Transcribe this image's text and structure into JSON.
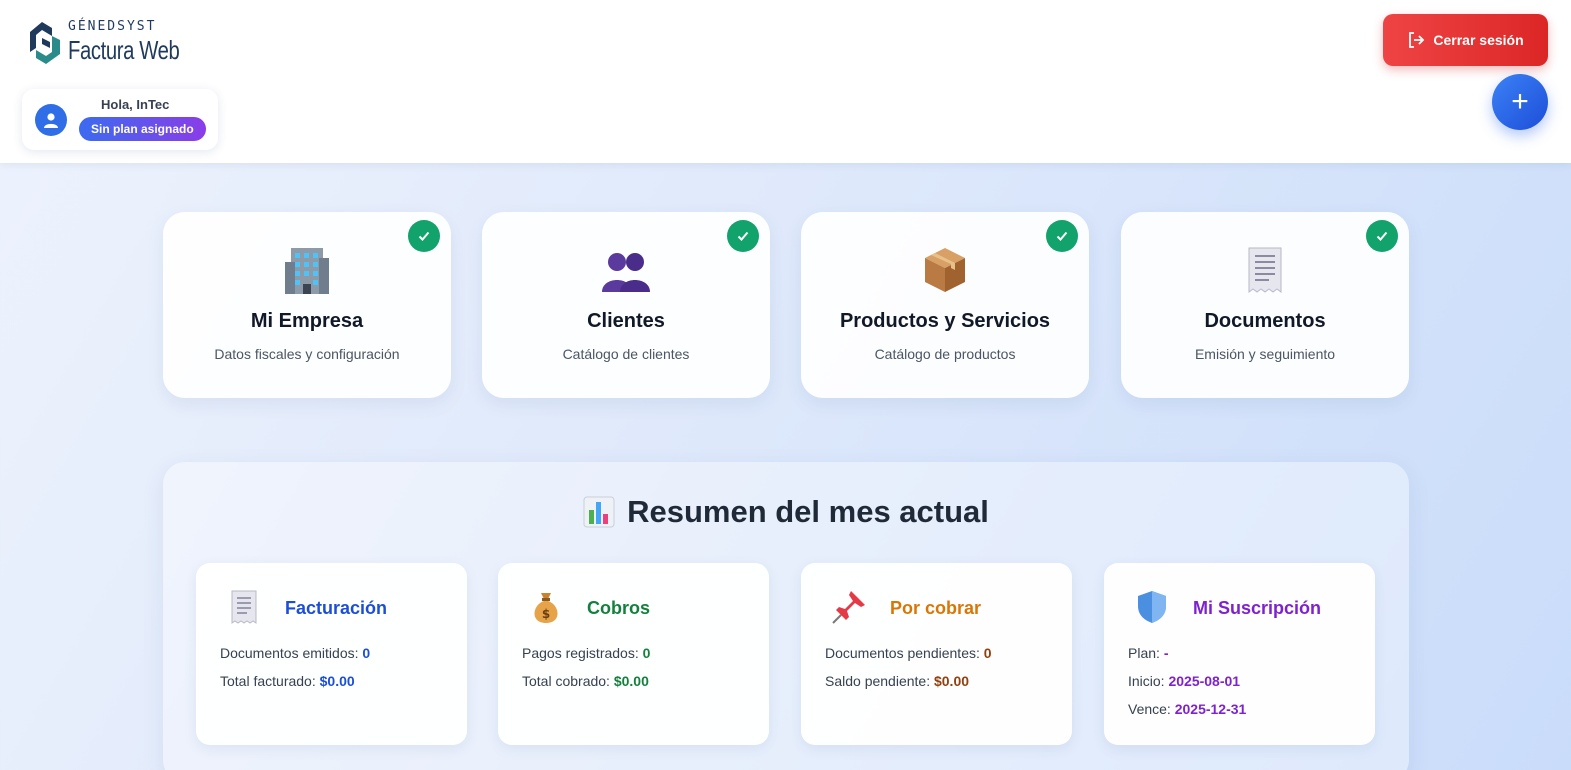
{
  "brand": {
    "top": "GÉNEDSYST",
    "bottom": "Factura Web"
  },
  "user": {
    "greeting": "Hola, InTec",
    "plan_badge": "Sin plan asignado"
  },
  "header": {
    "logout_label": "Cerrar sesión",
    "fab_label": "+"
  },
  "modules": [
    {
      "title": "Mi Empresa",
      "subtitle": "Datos fiscales y configuración",
      "icon": "office-building-icon"
    },
    {
      "title": "Clientes",
      "subtitle": "Catálogo de clientes",
      "icon": "people-icon"
    },
    {
      "title": "Productos y Servicios",
      "subtitle": "Catálogo de productos",
      "icon": "package-icon"
    },
    {
      "title": "Documentos",
      "subtitle": "Emisión y seguimiento",
      "icon": "receipt-icon"
    }
  ],
  "summary": {
    "title": "Resumen del mes actual",
    "cards": [
      {
        "title": "Facturación",
        "color": "#1d4ed8",
        "lines": [
          {
            "label": "Documentos emitidos:",
            "value": "0"
          },
          {
            "label": "Total facturado:",
            "value": "$0.00"
          }
        ]
      },
      {
        "title": "Cobros",
        "color": "#15803d",
        "lines": [
          {
            "label": "Pagos registrados:",
            "value": "0"
          },
          {
            "label": "Total cobrado:",
            "value": "$0.00"
          }
        ]
      },
      {
        "title": "Por cobrar",
        "color": "#d97706",
        "value_color": "#92400e",
        "lines": [
          {
            "label": "Documentos pendientes:",
            "value": "0"
          },
          {
            "label": "Saldo pendiente:",
            "value": "$0.00"
          }
        ]
      },
      {
        "title": "Mi Suscripción",
        "color": "#7e22ce",
        "lines": [
          {
            "label": "Plan:",
            "value": "-"
          },
          {
            "label": "Inicio:",
            "value": "2025-08-01"
          },
          {
            "label": "Vence:",
            "value": "2025-12-31"
          }
        ]
      }
    ]
  }
}
